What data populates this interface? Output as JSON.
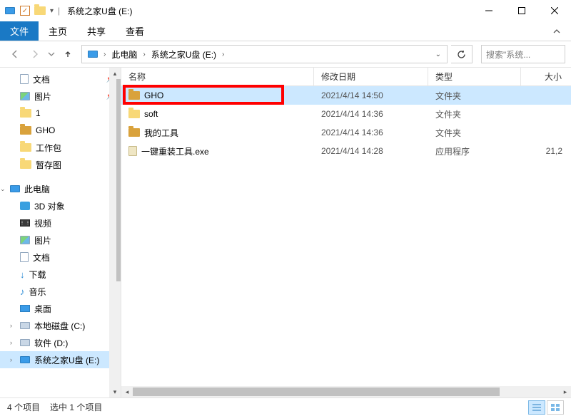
{
  "window": {
    "title": "系统之家U盘 (E:)"
  },
  "ribbon": {
    "file": "文件",
    "home": "主页",
    "share": "共享",
    "view": "查看"
  },
  "address": {
    "root": "此电脑",
    "current": "系统之家U盘 (E:)"
  },
  "search": {
    "placeholder": "搜索\"系统..."
  },
  "columns": {
    "name": "名称",
    "date": "修改日期",
    "type": "类型",
    "size": "大小"
  },
  "rows": [
    {
      "name": "GHO",
      "date": "2021/4/14 14:50",
      "type": "文件夹",
      "size": "",
      "icon": "folder-compressed",
      "selected": true,
      "highlighted": true
    },
    {
      "name": "soft",
      "date": "2021/4/14 14:36",
      "type": "文件夹",
      "size": "",
      "icon": "folder",
      "selected": false
    },
    {
      "name": "我的工具",
      "date": "2021/4/14 14:36",
      "type": "文件夹",
      "size": "",
      "icon": "folder-compressed",
      "selected": false
    },
    {
      "name": "一键重装工具.exe",
      "date": "2021/4/14 14:28",
      "type": "应用程序",
      "size": "21,2",
      "icon": "exe",
      "selected": false
    }
  ],
  "sidebar": {
    "quick": [
      {
        "label": "文档",
        "icon": "doc",
        "pinned": true
      },
      {
        "label": "图片",
        "icon": "img",
        "pinned": true
      },
      {
        "label": "1",
        "icon": "folder",
        "pinned": false
      },
      {
        "label": "GHO",
        "icon": "folder-compressed",
        "pinned": false
      },
      {
        "label": "工作包",
        "icon": "folder",
        "pinned": false
      },
      {
        "label": "暂存图",
        "icon": "folder",
        "pinned": false
      }
    ],
    "pc_label": "此电脑",
    "pc_children": [
      {
        "label": "3D 对象",
        "icon": "3d"
      },
      {
        "label": "视频",
        "icon": "vid"
      },
      {
        "label": "图片",
        "icon": "img"
      },
      {
        "label": "文档",
        "icon": "doc"
      },
      {
        "label": "下载",
        "icon": "dl"
      },
      {
        "label": "音乐",
        "icon": "music"
      },
      {
        "label": "桌面",
        "icon": "desktop"
      },
      {
        "label": "本地磁盘 (C:)",
        "icon": "disk"
      },
      {
        "label": "软件 (D:)",
        "icon": "disk"
      },
      {
        "label": "系统之家U盘 (E:)",
        "icon": "pc",
        "selected": true
      }
    ]
  },
  "status": {
    "count": "4 个项目",
    "selected": "选中 1 个项目"
  }
}
